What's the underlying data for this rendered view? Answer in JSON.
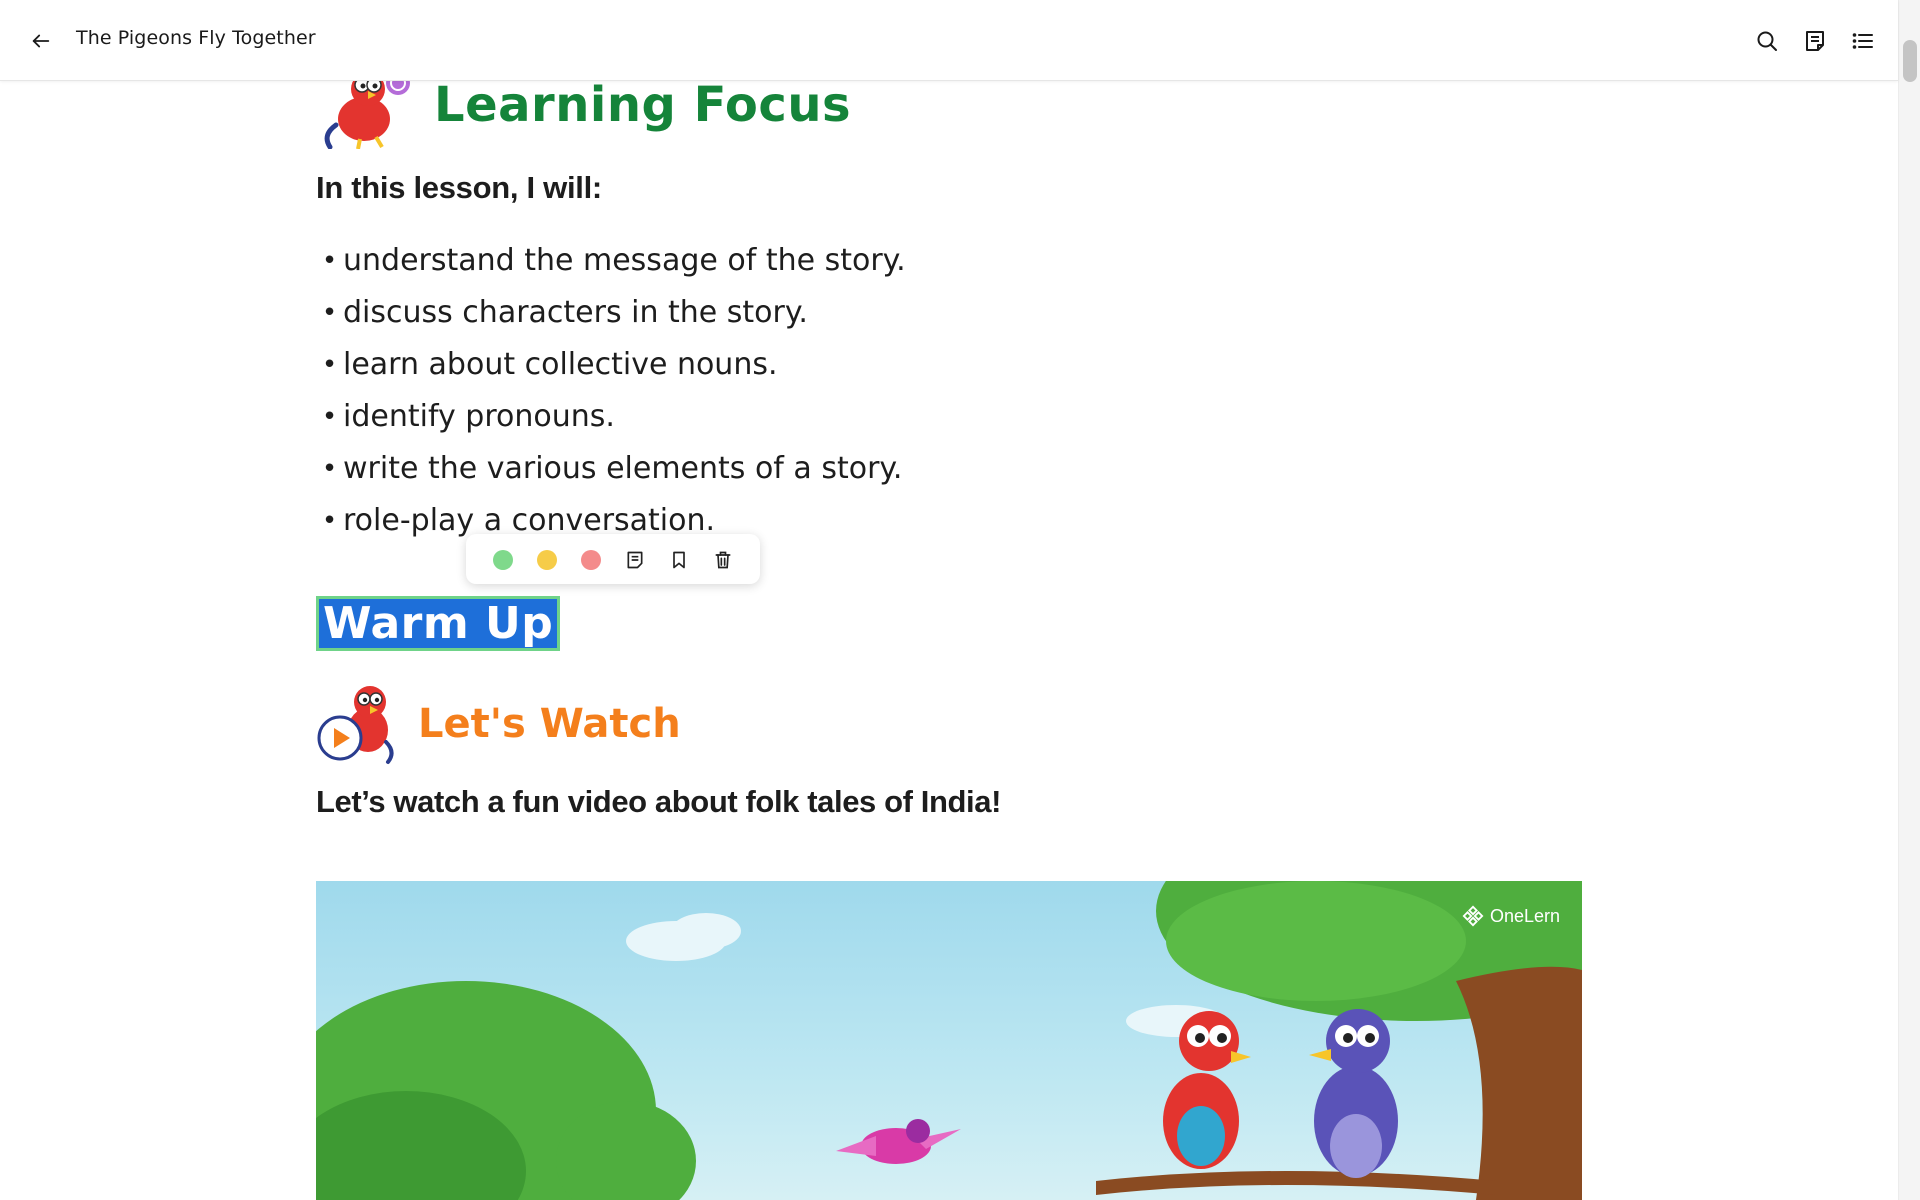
{
  "header": {
    "title": "The Pigeons Fly Together",
    "icons": {
      "back": "arrow-left-icon",
      "search": "search-icon",
      "notes": "notes-icon",
      "toc": "table-of-contents-icon"
    }
  },
  "learning_focus": {
    "heading": "Learning Focus",
    "intro": "In this lesson, I will:",
    "goals": [
      "understand the message of the story.",
      "discuss characters in the story.",
      "learn about collective nouns.",
      "identify pronouns.",
      "write the various elements of a story.",
      "role-play a conversation."
    ]
  },
  "highlight_toolbar": {
    "colors": {
      "green": "#7fd98b",
      "yellow": "#f6cc48",
      "red": "#f48b8b"
    },
    "icons": [
      "note-icon",
      "bookmark-icon",
      "trash-icon"
    ]
  },
  "warm_up": {
    "heading": "Warm Up",
    "selection_color": "#1e6fd9",
    "selection_border": "#6fd389"
  },
  "lets_watch": {
    "heading": "Let's Watch",
    "text": "Let’s watch a fun video about folk tales of India!"
  },
  "video": {
    "brand": "OneLern"
  },
  "colors": {
    "learning_focus": "#15843a",
    "lets_watch": "#f47f1c"
  }
}
